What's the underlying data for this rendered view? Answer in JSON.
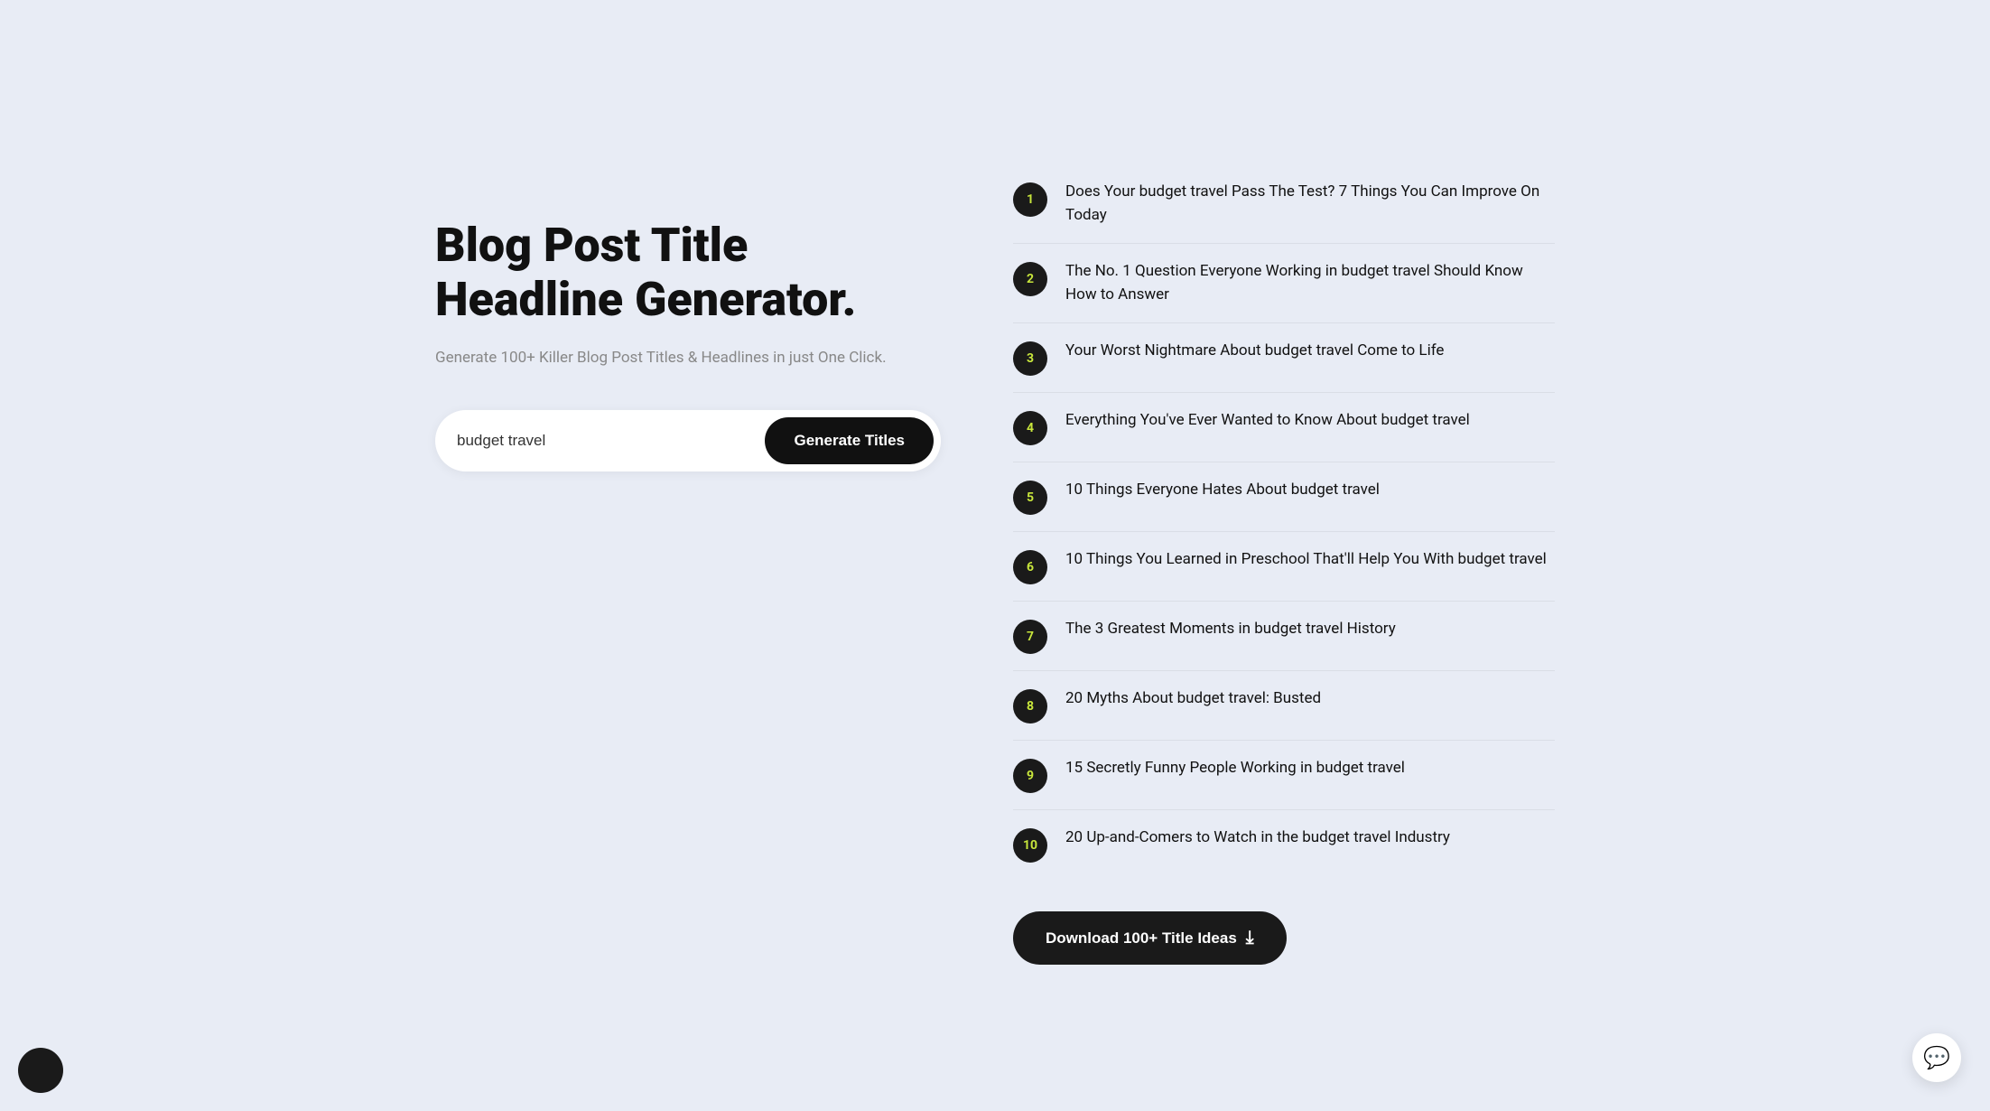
{
  "left": {
    "title": "Blog Post Title Headline Generator.",
    "subtitle": "Generate 100+ Killer Blog Post Titles & Headlines in just One Click.",
    "input": {
      "value": "budget travel",
      "placeholder": "budget travel"
    },
    "button": "Generate Titles"
  },
  "right": {
    "titles": [
      {
        "number": "1",
        "text": "Does Your budget travel Pass The Test? 7 Things You Can Improve On Today"
      },
      {
        "number": "2",
        "text": "The No. 1 Question Everyone Working in budget travel Should Know How to Answer"
      },
      {
        "number": "3",
        "text": "Your Worst Nightmare About budget travel Come to Life"
      },
      {
        "number": "4",
        "text": "Everything You've Ever Wanted to Know About budget travel"
      },
      {
        "number": "5",
        "text": "10 Things Everyone Hates About budget travel"
      },
      {
        "number": "6",
        "text": "10 Things You Learned in Preschool That'll Help You With budget travel"
      },
      {
        "number": "7",
        "text": "The 3 Greatest Moments in budget travel History"
      },
      {
        "number": "8",
        "text": "20 Myths About budget travel: Busted"
      },
      {
        "number": "9",
        "text": "15 Secretly Funny People Working in budget travel"
      },
      {
        "number": "10",
        "text": "20 Up-and-Comers to Watch in the budget travel Industry"
      }
    ],
    "download_button": "Download 100+ Title Ideas"
  }
}
